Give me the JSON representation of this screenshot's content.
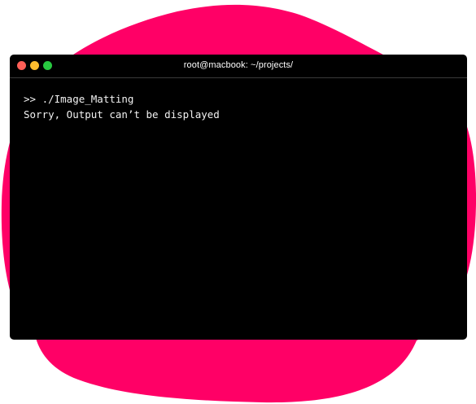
{
  "colors": {
    "blob": "#ff0066",
    "terminal_background": "#000000",
    "terminal_text": "#f2f2f2",
    "close_dot": "#ff5f57",
    "minimize_dot": "#febc2e",
    "maximize_dot": "#28c840"
  },
  "window": {
    "title": "root@macbook: ~/projects/",
    "controls": [
      "close-icon",
      "minimize-icon",
      "maximize-icon"
    ]
  },
  "terminal": {
    "lines": [
      ">> ./Image_Matting",
      "Sorry, Output can’t be displayed"
    ]
  }
}
